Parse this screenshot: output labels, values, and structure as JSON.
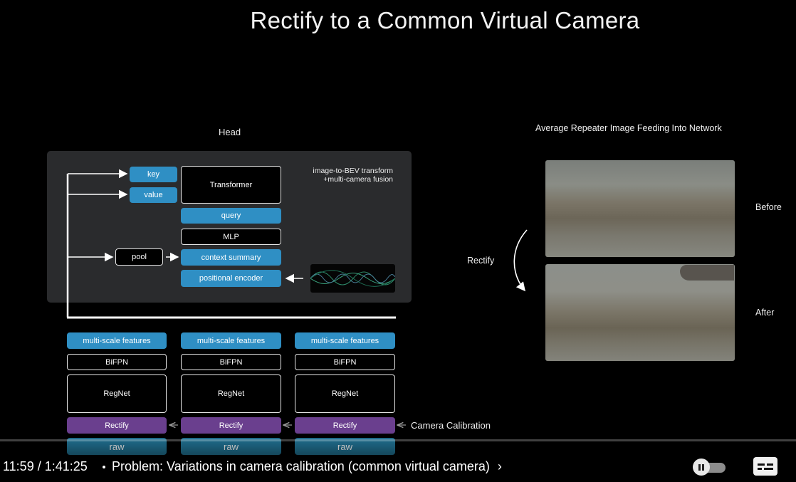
{
  "slide": {
    "title": "Rectify to a Common Virtual Camera",
    "head": {
      "label": "Head",
      "note_line1": "image-to-BEV transform",
      "note_line2": "+multi-camera fusion",
      "blocks": {
        "key": "key",
        "value": "value",
        "transformer": "Transformer",
        "query": "query",
        "mlp": "MLP",
        "pool": "pool",
        "context_summary": "context summary",
        "positional_encoder": "positional encoder"
      }
    },
    "columns": [
      {
        "features": "multi-scale features",
        "bifpn": "BiFPN",
        "regnet": "RegNet",
        "rectify": "Rectify",
        "raw": "raw"
      },
      {
        "features": "multi-scale features",
        "bifpn": "BiFPN",
        "regnet": "RegNet",
        "rectify": "Rectify",
        "raw": "raw"
      },
      {
        "features": "multi-scale features",
        "bifpn": "BiFPN",
        "regnet": "RegNet",
        "rectify": "Rectify",
        "raw": "raw"
      }
    ],
    "camera_calibration": "Camera Calibration",
    "right": {
      "heading": "Average Repeater Image Feeding Into Network",
      "before": "Before",
      "after": "After",
      "rectify": "Rectify"
    }
  },
  "player": {
    "timecode": "11:59 / 1:41:25",
    "chapter": "Problem: Variations in camera calibration (common virtual camera)",
    "colors": {
      "accent": "#2f8fc4",
      "purple": "#6a3f8e",
      "panel": "#2a2b2d"
    }
  }
}
